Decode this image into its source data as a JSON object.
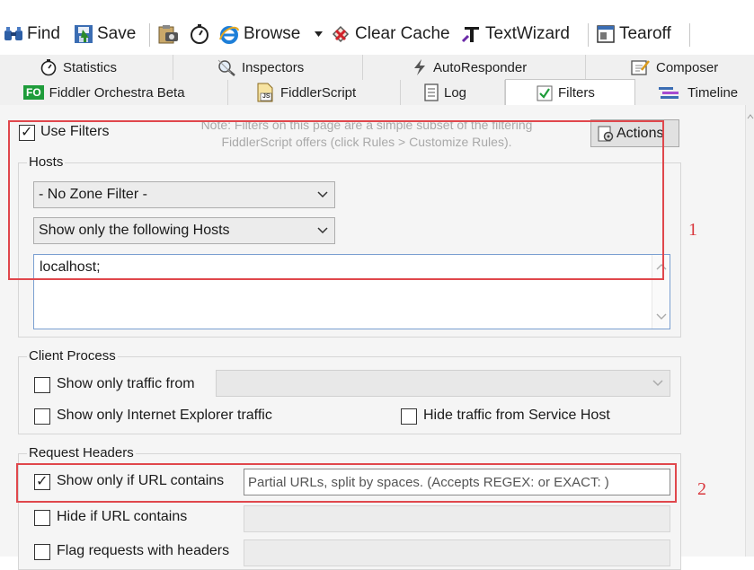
{
  "toolbar": {
    "find_label": "Find",
    "save_label": "Save",
    "browse_label": "Browse",
    "clear_cache_label": "Clear Cache",
    "text_wizard_label": "TextWizard",
    "tearoff_label": "Tearoff"
  },
  "tabs_row1": [
    {
      "label": "Statistics",
      "icon": "stopwatch-icon"
    },
    {
      "label": "Inspectors",
      "icon": "inspectors-icon"
    },
    {
      "label": "AutoResponder",
      "icon": "lightning-icon"
    },
    {
      "label": "Composer",
      "icon": "composer-icon"
    }
  ],
  "tabs_row2": [
    {
      "label": "Fiddler Orchestra Beta",
      "badge": "FO"
    },
    {
      "label": "FiddlerScript",
      "badge": "JS"
    },
    {
      "label": "Log",
      "icon": "log-icon"
    },
    {
      "label": "Filters",
      "icon": "checkbox-icon",
      "active": true
    },
    {
      "label": "Timeline",
      "icon": "timeline-icon"
    }
  ],
  "filters": {
    "use_filters_label": "Use Filters",
    "use_filters_checked": true,
    "note_line1": "Note: Filters on this page are a simple subset of the filtering",
    "note_line2": "FiddlerScript offers (click Rules > Customize Rules).",
    "actions_label": "Actions",
    "hosts": {
      "title": "Hosts",
      "zone_filter_value": "- No Zone Filter -",
      "host_mode_value": "Show only the following Hosts",
      "hosts_text": "localhost;"
    },
    "client_process": {
      "title": "Client Process",
      "show_only_traffic_from_label": "Show only traffic from",
      "show_only_ie_label": "Show only Internet Explorer traffic",
      "hide_service_host_label": "Hide traffic from Service Host"
    },
    "request_headers": {
      "title": "Request Headers",
      "show_if_url_contains_label": "Show only if URL contains",
      "show_if_url_contains_checked": true,
      "url_placeholder": "Partial URLs, split by spaces. (Accepts REGEX: or EXACT: )",
      "hide_if_url_contains_label": "Hide if URL contains",
      "flag_requests_label": "Flag requests with headers"
    }
  },
  "annotations": {
    "box1_number": "1",
    "box2_number": "2"
  },
  "colors": {
    "annotation_red": "#e0474c",
    "textarea_border": "#7a9fd1",
    "panel_bg": "#f5f5f5"
  }
}
